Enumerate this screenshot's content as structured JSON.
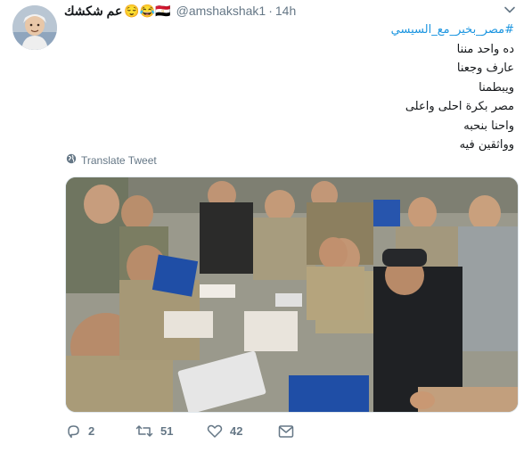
{
  "tweet": {
    "display_name": "عم شكشك",
    "emojis": "😌😂🇪🇬",
    "handle": "@amshakshak1",
    "separator": "·",
    "time": "14h",
    "hashtag": "#مصر_بخير_مع_السيسي",
    "lines": [
      "ده واحد مننا",
      "عارف وجعنا",
      "ويبطمنا",
      "مصر بكرة احلى واعلى",
      "واحنا بنحبه",
      "وواثقين فيه"
    ],
    "translate_label": "Translate Tweet"
  },
  "actions": {
    "replies": "2",
    "retweets": "51",
    "likes": "42"
  },
  "colors": {
    "link": "#1b95e0",
    "secondary": "#657786",
    "text": "#14171a"
  },
  "icons": [
    "chevron-down-icon",
    "globe-icon",
    "reply-icon",
    "retweet-icon",
    "like-icon",
    "message-icon"
  ]
}
